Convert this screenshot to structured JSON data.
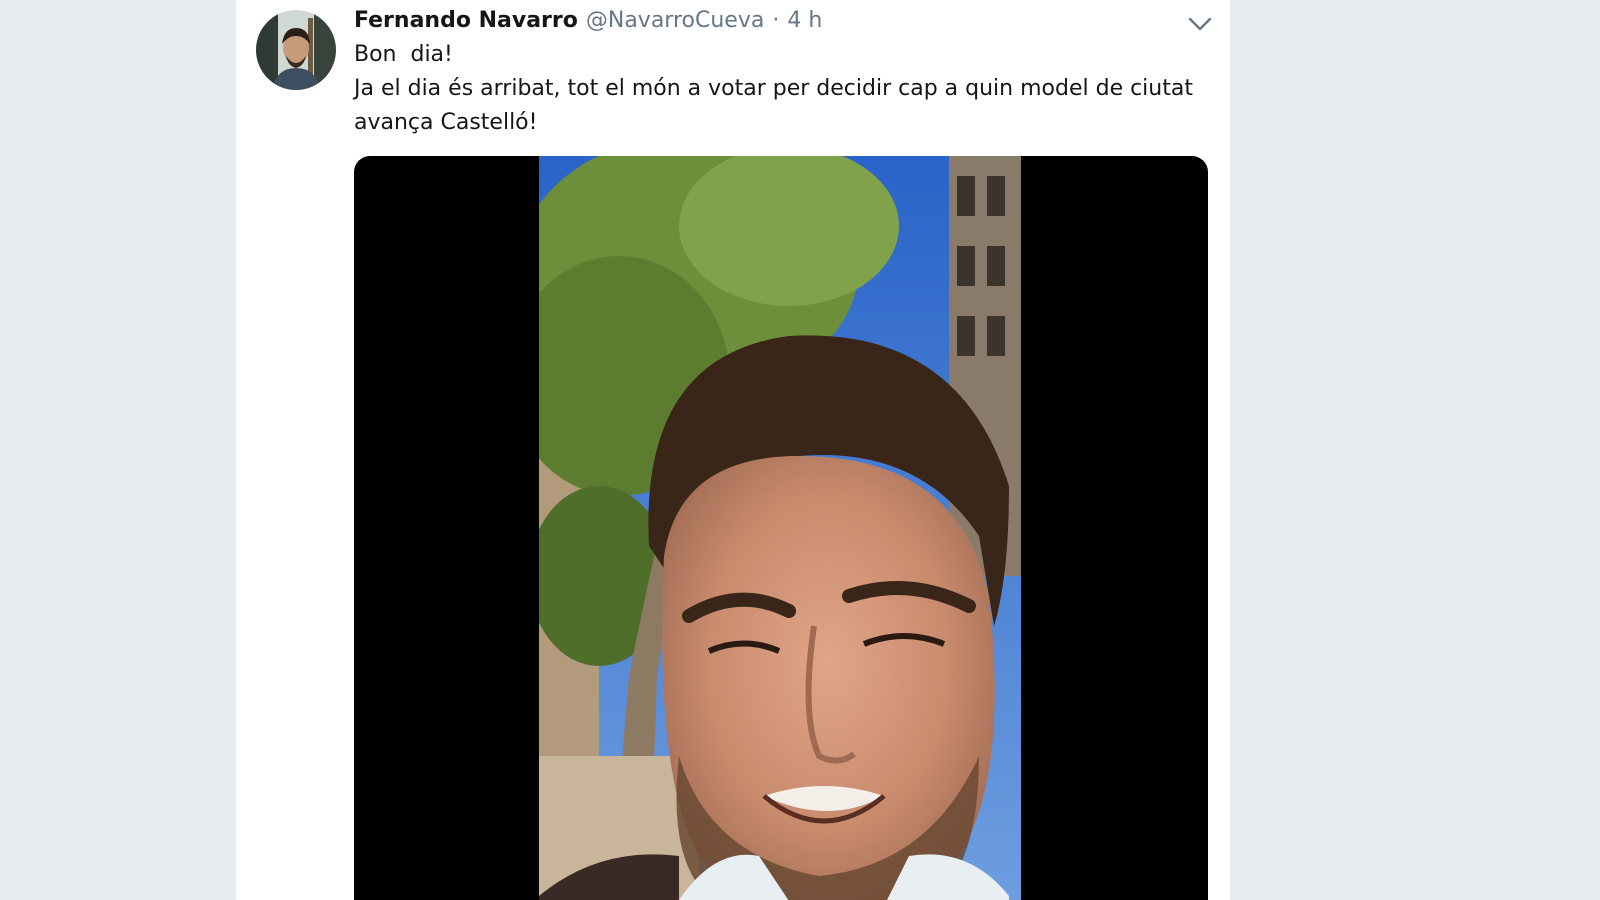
{
  "tweet": {
    "author_name": "Fernando Navarro",
    "handle": "@NavarroCueva",
    "separator": "·",
    "time": "4 h",
    "text_line1": "Bon  dia!",
    "text_line2": "Ja el dia és arribat, tot el món a votar per decidir cap a quin model de ciutat avança Castelló!"
  },
  "icons": {
    "caret": "chevron-down-icon"
  },
  "colors": {
    "background": "#e6ecf0",
    "card": "#ffffff",
    "text": "#14171a",
    "muted": "#657786",
    "video_bg": "#000000"
  }
}
